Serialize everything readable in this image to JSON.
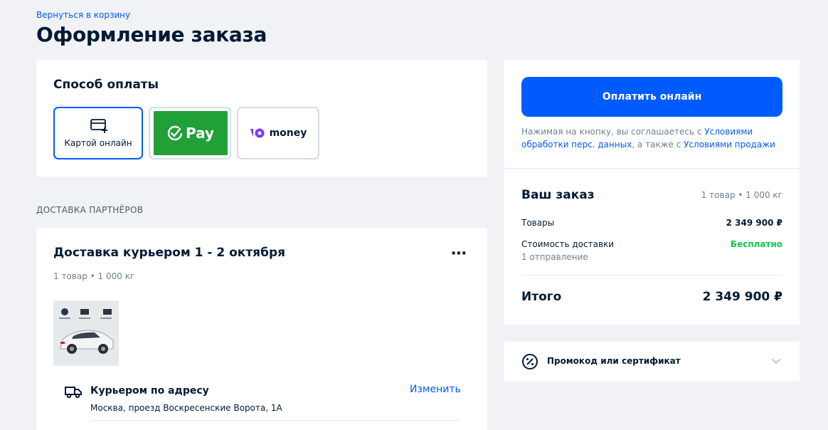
{
  "header": {
    "back_link": "Вернуться в корзину",
    "title": "Оформление заказа"
  },
  "payment": {
    "title": "Способ оплаты",
    "methods": [
      {
        "label": "Картой онлайн",
        "icon": "card-plus-icon"
      },
      {
        "label": "Pay",
        "icon": "sber-check-icon"
      },
      {
        "label": "money",
        "icon": "yoo-icon"
      }
    ]
  },
  "delivery_section_label": "ДОСТАВКА ПАРТНЁРОВ",
  "delivery": {
    "title": "Доставка курьером 1 - 2 октября",
    "subtitle": "1 товар • 1 000 кг",
    "more_icon": "more-dots-icon",
    "courier_title": "Курьером по адресу",
    "change_link": "Изменить",
    "address": "Москва, проезд Воскресенские Ворота, 1А"
  },
  "summary": {
    "pay_button": "Оплатить онлайн",
    "agree_text_1": "Нажимая на кнопку, вы соглашаетесь с ",
    "agree_link_1": "Условиями обработки перс. данных",
    "agree_text_2": ", а также с ",
    "agree_link_2": "Условиями продажи",
    "your_order": "Ваш заказ",
    "order_meta": "1 товар • 1 000 кг",
    "goods_label": "Товары",
    "goods_value": "2 349 900 ₽",
    "delivery_label": "Стоимость доставки",
    "delivery_value": "Бесплатно",
    "delivery_sub": "1 отправление",
    "total_label": "Итого",
    "total_value": "2 349 900 ₽"
  },
  "promo": {
    "label": "Промокод или сертификат"
  },
  "colors": {
    "accent": "#005bff",
    "sber": "#21a038",
    "free": "#10c44c",
    "yoo": "#7b3bff"
  }
}
